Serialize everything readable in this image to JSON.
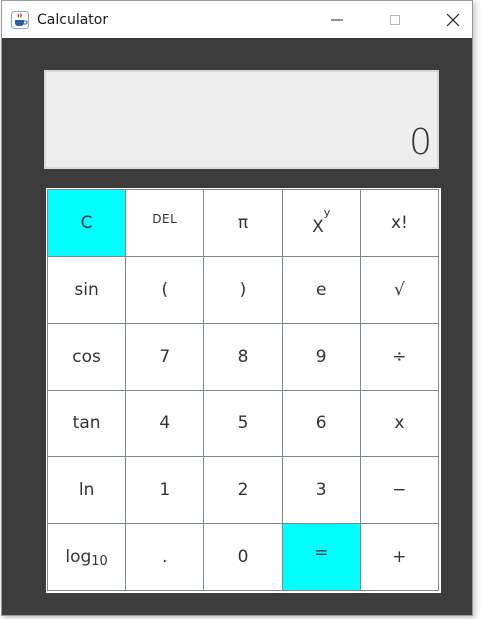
{
  "window": {
    "title": "Calculator",
    "controls": {
      "minimize": "minimize-icon",
      "maximize": "maximize-icon",
      "close": "close-icon"
    }
  },
  "display": {
    "value": "0"
  },
  "keys": {
    "clear": "C",
    "delete": "DEL",
    "pi": "π",
    "power_base": "X",
    "power_exp": "y",
    "factorial": "x!",
    "sin": "sin",
    "open_paren": "(",
    "close_paren": ")",
    "e": "e",
    "sqrt": "√",
    "cos": "cos",
    "seven": "7",
    "eight": "8",
    "nine": "9",
    "divide": "÷",
    "tan": "tan",
    "four": "4",
    "five": "5",
    "six": "6",
    "multiply": "x",
    "ln": "ln",
    "one": "1",
    "two": "2",
    "three": "3",
    "minus": "−",
    "log_base": "log",
    "log_sub": "10",
    "dot": ".",
    "zero": "0",
    "equals": "=",
    "plus": "+"
  },
  "colors": {
    "accent": "#00ffff",
    "frame": "#3c3c3c",
    "display_bg": "#eeeeee"
  }
}
